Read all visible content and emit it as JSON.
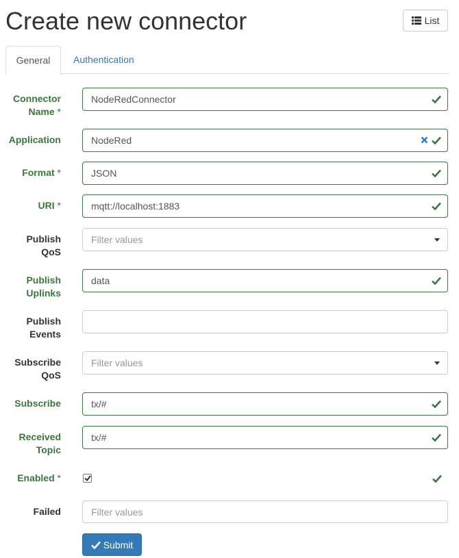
{
  "header": {
    "title": "Create new connector",
    "list_button_label": "List",
    "list_icon": "list-icon"
  },
  "tabs": [
    {
      "label": "General",
      "active": true
    },
    {
      "label": "Authentication",
      "active": false
    }
  ],
  "form": {
    "connector_name": {
      "label": "Connector Name",
      "required_mark": "*",
      "value": "NodeRedConnector",
      "valid": true
    },
    "application": {
      "label": "Application",
      "value": "NodeRed",
      "valid": true,
      "clear_icon": "clear-x-icon"
    },
    "format": {
      "label": "Format",
      "required_mark": "*",
      "value": "JSON",
      "valid": true
    },
    "uri": {
      "label": "URI",
      "required_mark": "*",
      "value": "mqtt://localhost:1883",
      "valid": true
    },
    "publish_qos": {
      "label": "Publish QoS",
      "placeholder": "Filter values",
      "valid": false
    },
    "publish_uplinks": {
      "label": "Publish Uplinks",
      "value": "data",
      "valid": true
    },
    "publish_events": {
      "label": "Publish Events",
      "value": "",
      "valid": false
    },
    "subscribe_qos": {
      "label": "Subscribe QoS",
      "placeholder": "Filter values",
      "valid": false
    },
    "subscribe": {
      "label": "Subscribe",
      "value": "tx/#",
      "valid": true
    },
    "received_topic": {
      "label": "Received Topic",
      "value": "tx/#",
      "valid": true
    },
    "enabled": {
      "label": "Enabled",
      "required_mark": "*",
      "checked": true,
      "valid": true
    },
    "failed": {
      "label": "Failed",
      "placeholder": "Filter values",
      "valid": false
    }
  },
  "submit_label": "Submit",
  "colors": {
    "valid_green": "#3c763d",
    "primary_blue": "#337ab7",
    "link_blue": "#337ab7",
    "border_gray": "#cccccc"
  }
}
